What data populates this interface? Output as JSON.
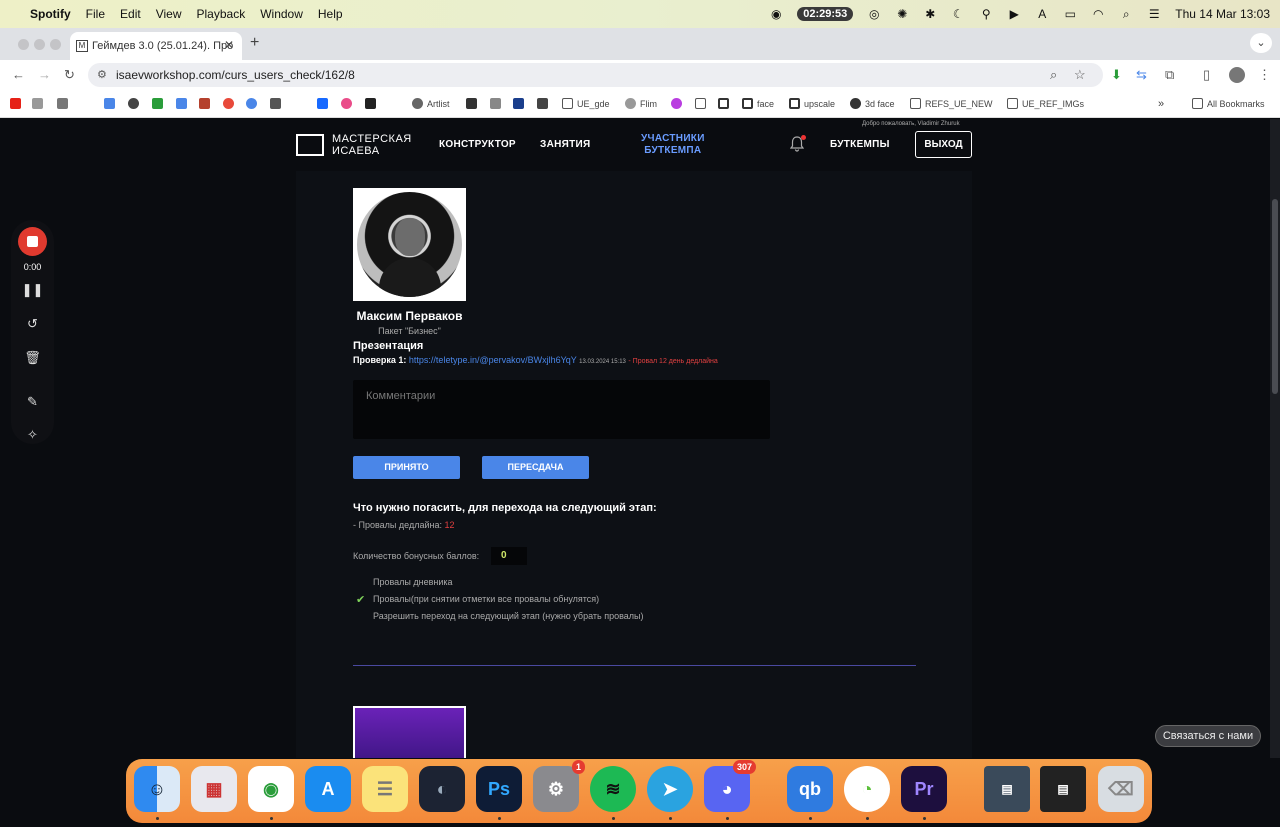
{
  "menubar": {
    "app": "Spotify",
    "items": [
      "File",
      "Edit",
      "View",
      "Playback",
      "Window",
      "Help"
    ],
    "timer": "02:29:53",
    "datetime": "Thu 14 Mar  13:03"
  },
  "browser": {
    "tab_title": "Геймдев 3.0 (25.01.24). Про",
    "url": "isaevworkshop.com/curs_users_check/162/8",
    "bookmarks": [
      "Artlist",
      "UE_gde",
      "Flim",
      "face",
      "upscale",
      "3d face",
      "REFS_UE_NEW",
      "UE_REF_IMGs"
    ],
    "all_bookmarks": "All Bookmarks"
  },
  "site": {
    "logo_line1": "МАСТЕРСКАЯ",
    "logo_line2": "ИСАЕВА",
    "nav": {
      "constructor": "КОНСТРУКТОР",
      "lessons": "ЗАНЯТИЯ",
      "participants_line1": "УЧАСТНИКИ",
      "participants_line2": "БУТКЕМПА",
      "bootcamps": "БУТКЕМПЫ",
      "logout": "ВЫХОД"
    },
    "welcome": "Добро пожаловать, Vladimir Zhuruk"
  },
  "user": {
    "name": "Максим Перваков",
    "package": "Пакет \"Бизнес\"",
    "section": "Презентация",
    "check_label": "Проверка 1:",
    "check_link": "https://teletype.in/@pervakov/BWxjlh6YqY",
    "check_date": "13.03.2024 15:13",
    "check_fail": "- Провал 12 день дедлайна",
    "comment_placeholder": "Комментарии",
    "accept": "ПРИНЯТО",
    "retake": "ПЕРЕСДАЧА",
    "question": "Что нужно погасить, для перехода на следующий этап:",
    "deadline_fails_label": "- Провалы дедлайна:",
    "deadline_fails_count": "12",
    "bonus_label": "Количество бонусных баллов:",
    "bonus_value": "0",
    "options": [
      "Провалы дневника",
      "Провалы(при снятии отметки все провалы обнулятся)",
      "Разрешить переход на следующий этап (нужно убрать провалы)"
    ]
  },
  "contact": "Связаться с нами",
  "recorder": {
    "time": "0:00"
  },
  "dock": {
    "badges": {
      "settings": "1",
      "discord": "307"
    },
    "apps": [
      "Finder",
      "Launchpad",
      "Chrome",
      "App Store",
      "Notes",
      "Cinema 4D",
      "Photoshop",
      "System Settings",
      "Spotify",
      "Telegram",
      "Discord",
      "qBittorrent",
      "Arc",
      "Premiere Pro",
      "Trash"
    ],
    "ps_label": "Ps",
    "pr_label": "Pr",
    "qb_label": "qb"
  },
  "colors": {
    "accent": "#4a86e8",
    "fail": "#e04040",
    "active_nav": "#6a9cff",
    "dock": "#f3893a"
  }
}
